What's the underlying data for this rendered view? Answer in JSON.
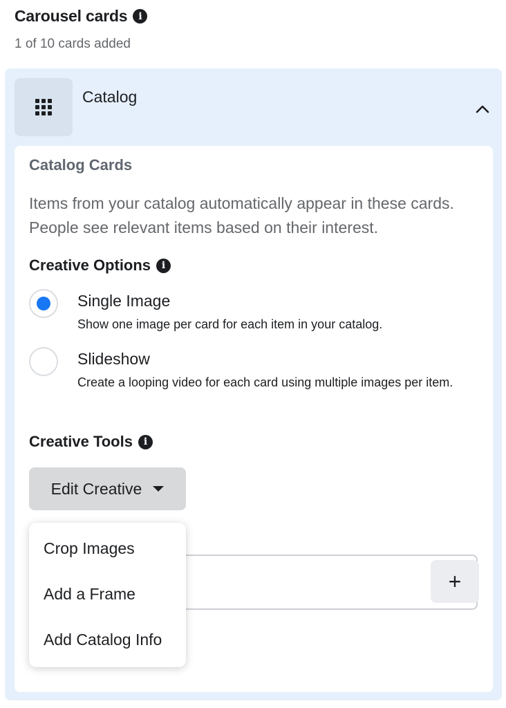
{
  "header": {
    "title": "Carousel cards",
    "subtitle": "1 of 10 cards added"
  },
  "catalog_section": {
    "label": "Catalog"
  },
  "catalog_cards": {
    "title": "Catalog Cards",
    "description": "Items from your catalog automatically appear in these cards. People see relevant items based on their interest."
  },
  "creative_options": {
    "title": "Creative Options",
    "options": [
      {
        "label": "Single Image",
        "description": "Show one image per card for each item in your catalog.",
        "selected": true
      },
      {
        "label": "Slideshow",
        "description": "Create a looping video for each card using multiple images per item.",
        "selected": false
      }
    ]
  },
  "creative_tools": {
    "title": "Creative Tools",
    "button_label": "Edit Creative",
    "menu": [
      "Crop Images",
      "Add a Frame",
      "Add Catalog Info"
    ]
  },
  "add_button": {
    "symbol": "+"
  },
  "colors": {
    "panel_bg": "#e6f0fc",
    "radio_selected": "#1877f2",
    "button_bg": "#d8d9db"
  },
  "icons": [
    "info-icon",
    "grid-icon",
    "chevron-up-icon",
    "caret-down-icon",
    "plus-icon"
  ]
}
